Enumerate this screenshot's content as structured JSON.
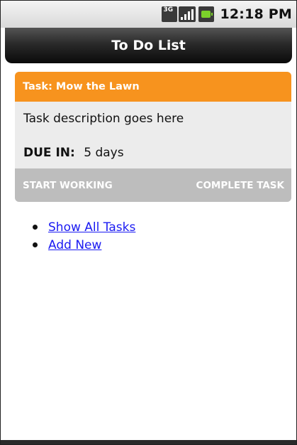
{
  "status_bar": {
    "network_label": "3G",
    "clock": "12:18 PM",
    "battery_color": "#7bd12a"
  },
  "header": {
    "title": "To Do List"
  },
  "task": {
    "title": "Task: Mow the Lawn",
    "description": "Task description goes here",
    "due_label": "DUE IN:",
    "due_value": "5 days",
    "header_color": "#f7931e",
    "actions": {
      "start_label": "START WORKING",
      "complete_label": "COMPLETE TASK"
    }
  },
  "links": [
    {
      "label": "Show All Tasks"
    },
    {
      "label": "Add New"
    }
  ]
}
